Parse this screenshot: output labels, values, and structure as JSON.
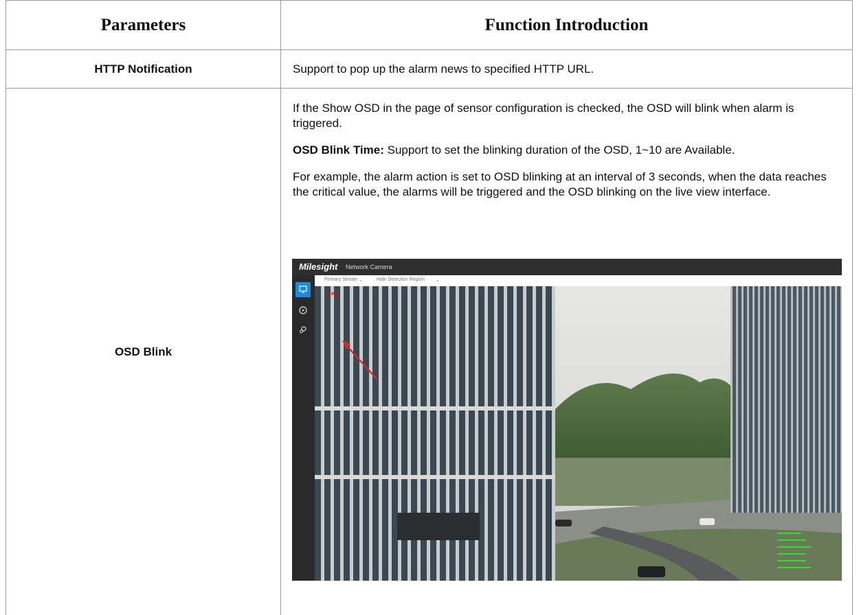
{
  "table": {
    "headers": [
      "Parameters",
      "Function Introduction"
    ],
    "rows": [
      {
        "parameter": "HTTP Notification",
        "description": "Support to pop up the alarm news to specified HTTP URL."
      },
      {
        "parameter": "OSD Blink",
        "para1": "If the Show OSD in the page of sensor configuration is checked, the OSD will blink when alarm is triggered.",
        "blink_time_label": "OSD Blink Time:",
        "blink_time_text": " Support to set the blinking duration of the OSD, 1~10 are Available.",
        "para3": "For example, the alarm action is set to OSD blinking at an interval of 3 seconds, when the data reaches the critical value, the alarms will be triggered and the OSD blinking on the live view interface."
      }
    ]
  },
  "screenshot": {
    "brand": "Milesight",
    "subtitle": "Network Camera",
    "stream_select": "Primary Stream",
    "region_select": "Hide Detection Region",
    "osd_value": "0℃",
    "colors": {
      "osd": "#c01818",
      "accent": "#1a8be0",
      "overlay_text": "#2ee02e"
    },
    "icons": [
      "live-view-icon",
      "playback-icon",
      "settings-icon"
    ]
  }
}
